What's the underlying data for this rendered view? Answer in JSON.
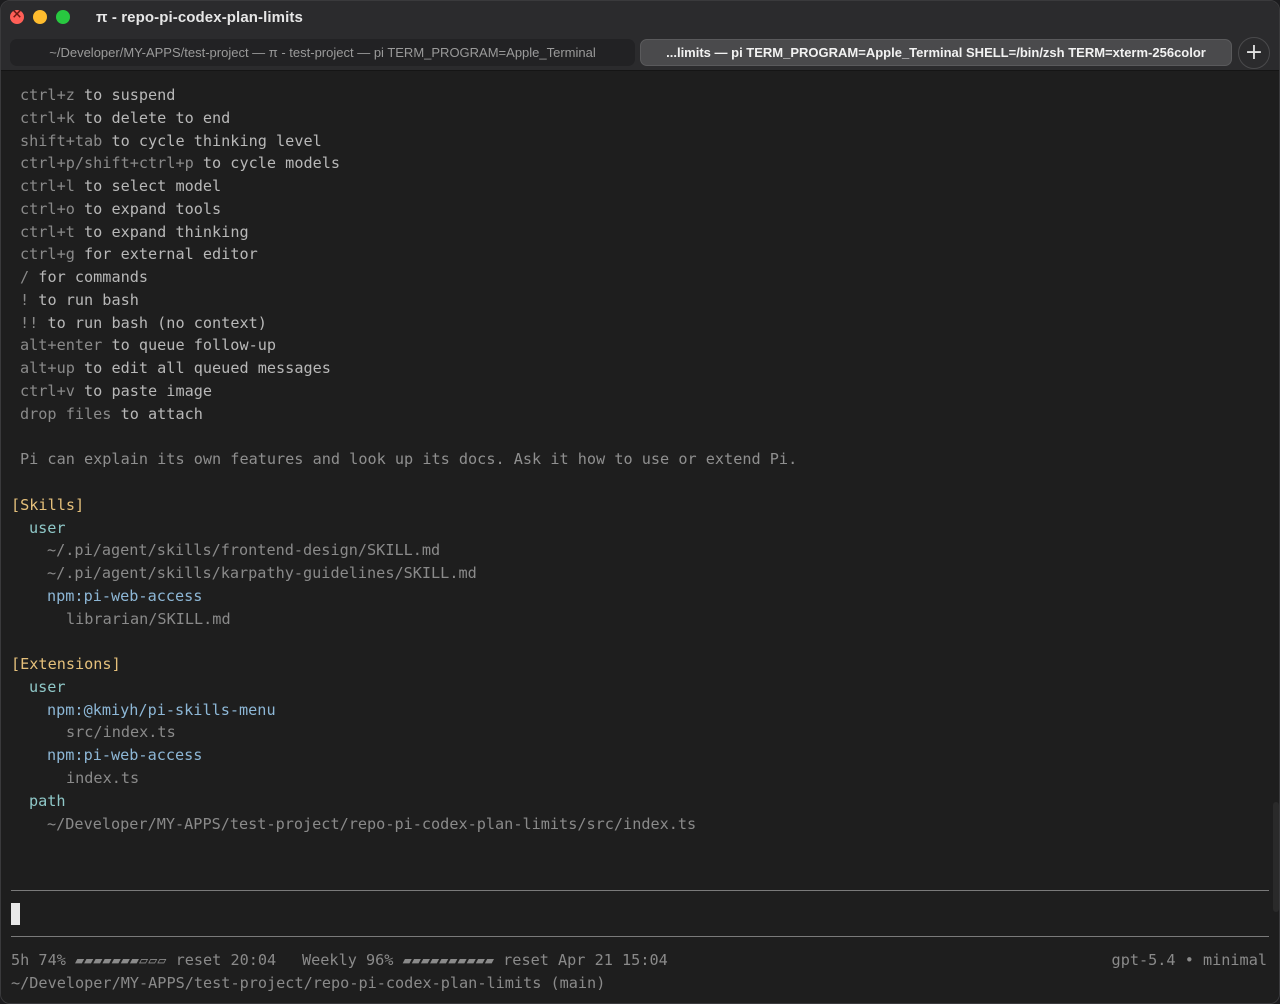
{
  "window": {
    "title": "π - repo-pi-codex-plan-limits"
  },
  "tabs": [
    {
      "label": "~/Developer/MY-APPS/test-project — π - test-project — pi TERM_PROGRAM=Apple_Terminal",
      "active": false
    },
    {
      "label": "...limits — pi TERM_PROGRAM=Apple_Terminal SHELL=/bin/zsh TERM=xterm-256color",
      "active": true
    }
  ],
  "new_tab_label": "+",
  "shortcuts": [
    {
      "key": "ctrl+z",
      "desc": " to suspend"
    },
    {
      "key": "ctrl+k",
      "desc": " to delete to end"
    },
    {
      "key": "shift+tab",
      "desc": " to cycle thinking level"
    },
    {
      "key": "ctrl+p/shift+ctrl+p",
      "desc": " to cycle models"
    },
    {
      "key": "ctrl+l",
      "desc": " to select model"
    },
    {
      "key": "ctrl+o",
      "desc": " to expand tools"
    },
    {
      "key": "ctrl+t",
      "desc": " to expand thinking"
    },
    {
      "key": "ctrl+g",
      "desc": " for external editor"
    },
    {
      "key": "/",
      "desc": " for commands"
    },
    {
      "key": "!",
      "desc": " to run bash"
    },
    {
      "key": "!!",
      "desc": " to run bash (no context)"
    },
    {
      "key": "alt+enter",
      "desc": " to queue follow-up"
    },
    {
      "key": "alt+up",
      "desc": " to edit all queued messages"
    },
    {
      "key": "ctrl+v",
      "desc": " to paste image"
    },
    {
      "key": "drop files",
      "desc": " to attach"
    }
  ],
  "info_line": "Pi can explain its own features and look up its docs. Ask it how to use or extend Pi.",
  "skills": {
    "header": "[Skills]",
    "scope": "user",
    "items": [
      "~/.pi/agent/skills/frontend-design/SKILL.md",
      "~/.pi/agent/skills/karpathy-guidelines/SKILL.md"
    ],
    "package": "npm:pi-web-access",
    "package_items": [
      "librarian/SKILL.md"
    ]
  },
  "extensions": {
    "header": "[Extensions]",
    "scope": "user",
    "packages": [
      {
        "name": "npm:@kmiyh/pi-skills-menu",
        "file": "src/index.ts"
      },
      {
        "name": "npm:pi-web-access",
        "file": "index.ts"
      }
    ],
    "path_label": "path",
    "path_value": "~/Developer/MY-APPS/test-project/repo-pi-codex-plan-limits/src/index.ts"
  },
  "status": {
    "usage_5h": "5h 74% ▰▰▰▰▰▰▰▱▱▱ reset 20:04",
    "usage_weekly": "Weekly 96% ▰▰▰▰▰▰▰▰▰▰ reset Apr 21 15:04",
    "model": "gpt-5.4 • minimal",
    "cwd": "~/Developer/MY-APPS/test-project/repo-pi-codex-plan-limits (main)"
  },
  "colors": {
    "background": "#1e1e1e",
    "section_header": "#e5c07b",
    "scope_label": "#8fc8c8",
    "package_name": "#8db7d6",
    "muted_text": "#8a8a8a"
  }
}
